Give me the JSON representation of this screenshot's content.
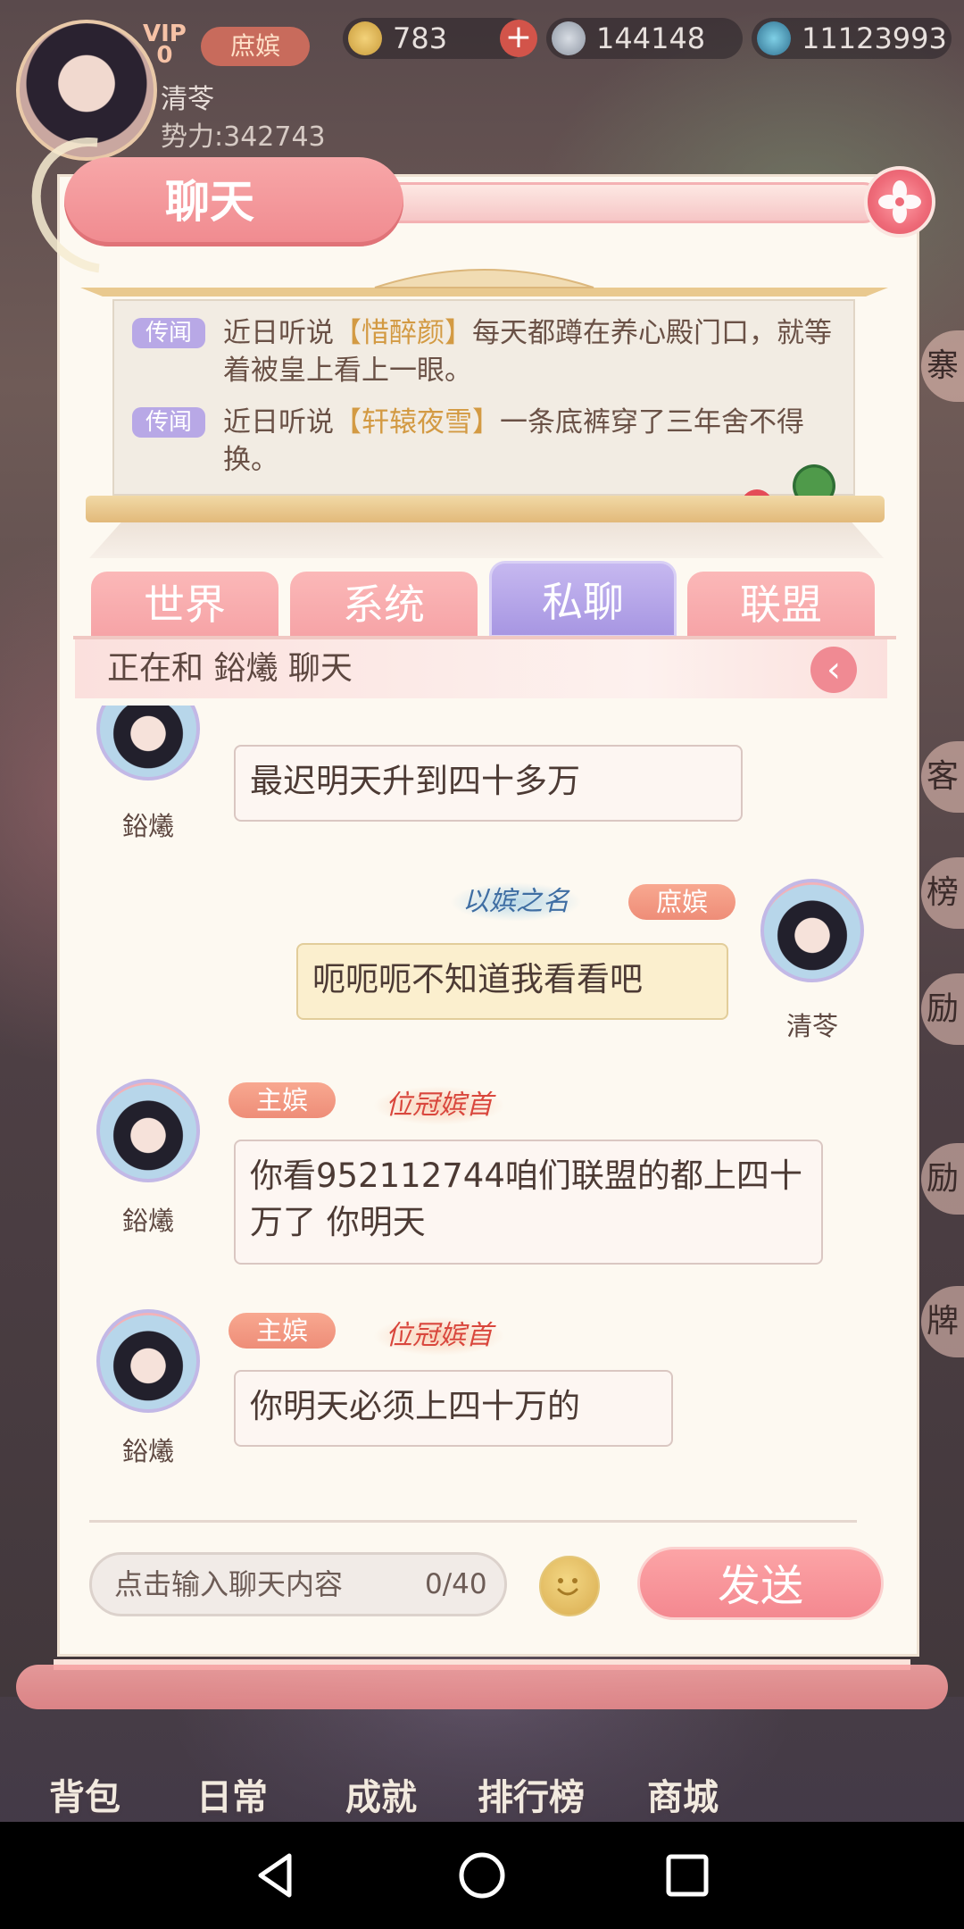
{
  "hud": {
    "vip_label": "VIP",
    "vip_level": "0",
    "rank": "庶嫔",
    "gold": "783",
    "silver": "144148",
    "orb": "11123993",
    "player_name": "清苓",
    "power": "势力:342743"
  },
  "panel": {
    "title": "聊天"
  },
  "rumors": [
    {
      "tag": "传闻",
      "pre": "近日听说",
      "name": "【惜醉颜】",
      "post": "每天都蹲在养心殿门口，就等着被皇上看上一眼。"
    },
    {
      "tag": "传闻",
      "pre": "近日听说",
      "name": "【轩辕夜雪】",
      "post": "一条底裤穿了三年舍不得换。"
    }
  ],
  "tabs": [
    "世界",
    "系统",
    "私聊",
    "联盟"
  ],
  "active_tab": "私聊",
  "chat_with": "正在和 鋊爔 聊天",
  "messages": [
    {
      "side": "left",
      "user": "鋊爔",
      "text": "最迟明天升到四十多万"
    },
    {
      "side": "right",
      "user": "清苓",
      "rank": "庶嫔",
      "title": "以嫔之名",
      "text": "呃呃呃不知道我看看吧"
    },
    {
      "side": "left",
      "user": "鋊爔",
      "rank": "主嫔",
      "title": "位冠嫔首",
      "text": "你看952112744咱们联盟的都上四十万了  你明天"
    },
    {
      "side": "left",
      "user": "鋊爔",
      "rank": "主嫔",
      "title": "位冠嫔首",
      "text": "你明天必须上四十万的"
    }
  ],
  "input": {
    "placeholder": "点击输入聊天内容",
    "count": "0/40",
    "send_label": "发送"
  },
  "side_labels": [
    "寨",
    "客",
    "榜",
    "励",
    "励",
    "牌"
  ],
  "bottom_nav": [
    "背包",
    "日常",
    "成就",
    "排行榜",
    "商城"
  ],
  "colors": {
    "accent_pink": "#f48890",
    "active_tab": "#a796e2",
    "panel_bg": "#fdf9f1"
  }
}
